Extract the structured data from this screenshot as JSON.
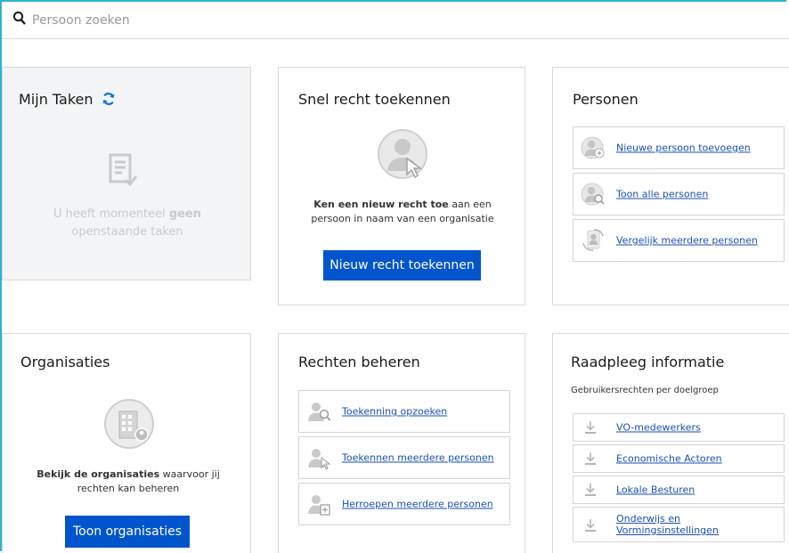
{
  "search": {
    "placeholder": "Persoon zoeken",
    "icon": "search-icon"
  },
  "taken": {
    "title": "Mijn Taken",
    "empty_part1": "U heeft momenteel ",
    "empty_bold": "geen",
    "empty_part2": "openstaande taken"
  },
  "snel": {
    "title": "Snel recht toekennen",
    "desc_bold": "Ken een nieuw recht toe",
    "desc_rest1": " aan een",
    "desc_rest2": "persoon in naam van een organisatie",
    "button": "Nieuw recht toekennen"
  },
  "personen": {
    "title": "Personen",
    "items": [
      {
        "label": "Nieuwe persoon toevoegen"
      },
      {
        "label": "Toon alle personen"
      },
      {
        "label": "Vergelijk meerdere personen"
      }
    ]
  },
  "organisaties": {
    "title": "Organisaties",
    "desc_bold": "Bekijk de organisaties",
    "desc_rest1": " waarvoor jij",
    "desc_rest2": "rechten kan beheren",
    "button": "Toon organisaties"
  },
  "rechten": {
    "title": "Rechten beheren",
    "items": [
      {
        "label": "Toekenning opzoeken"
      },
      {
        "label": "Toekennen meerdere personen"
      },
      {
        "label": "Herroepen meerdere personen"
      }
    ]
  },
  "raadpleeg": {
    "title": "Raadpleeg informatie",
    "subtitle": "Gebruikersrechten per doelgroep",
    "items": [
      {
        "label": "VO-medewerkers"
      },
      {
        "label": "Economische Actoren"
      },
      {
        "label": "Lokale Besturen"
      },
      {
        "label": "Onderwijs en Vormingsinstellingen"
      }
    ]
  },
  "colors": {
    "accent": "#0055cc",
    "frame": "#2bb3d0",
    "link": "#1a4fb5"
  }
}
